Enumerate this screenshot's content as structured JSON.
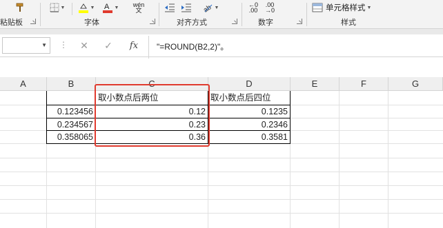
{
  "ribbon": {
    "clipboard_label": "粘贴板",
    "font_label": "字体",
    "align_label": "对齐方式",
    "number_label": "数字",
    "style_label": "样式",
    "cell_style_label": "单元格样式",
    "wen_top": "wén",
    "wen_bottom": "文",
    "dec_inc_top": "←0",
    "dec_inc_bottom": ".00",
    "dec_dec_top": ".00",
    "dec_dec_bottom": "→0",
    "colors": {
      "fill": "#ffff00",
      "font": "#e03a2e"
    }
  },
  "formula_bar": {
    "name_box_value": "",
    "fx_label": "fx",
    "formula": "\"=ROUND(B2,2)\"。"
  },
  "columns": [
    "A",
    "B",
    "C",
    "D",
    "E",
    "F",
    "G"
  ],
  "table": {
    "header_c": "取小数点后两位",
    "header_d": "取小数点后四位",
    "b_values": [
      "0.123456",
      "0.234567",
      "0.358065"
    ],
    "c_values": [
      "0.12",
      "0.23",
      "0.36"
    ],
    "d_values": [
      "0.1235",
      "0.2346",
      "0.3581"
    ]
  },
  "highlight_color": "#e03a2e"
}
